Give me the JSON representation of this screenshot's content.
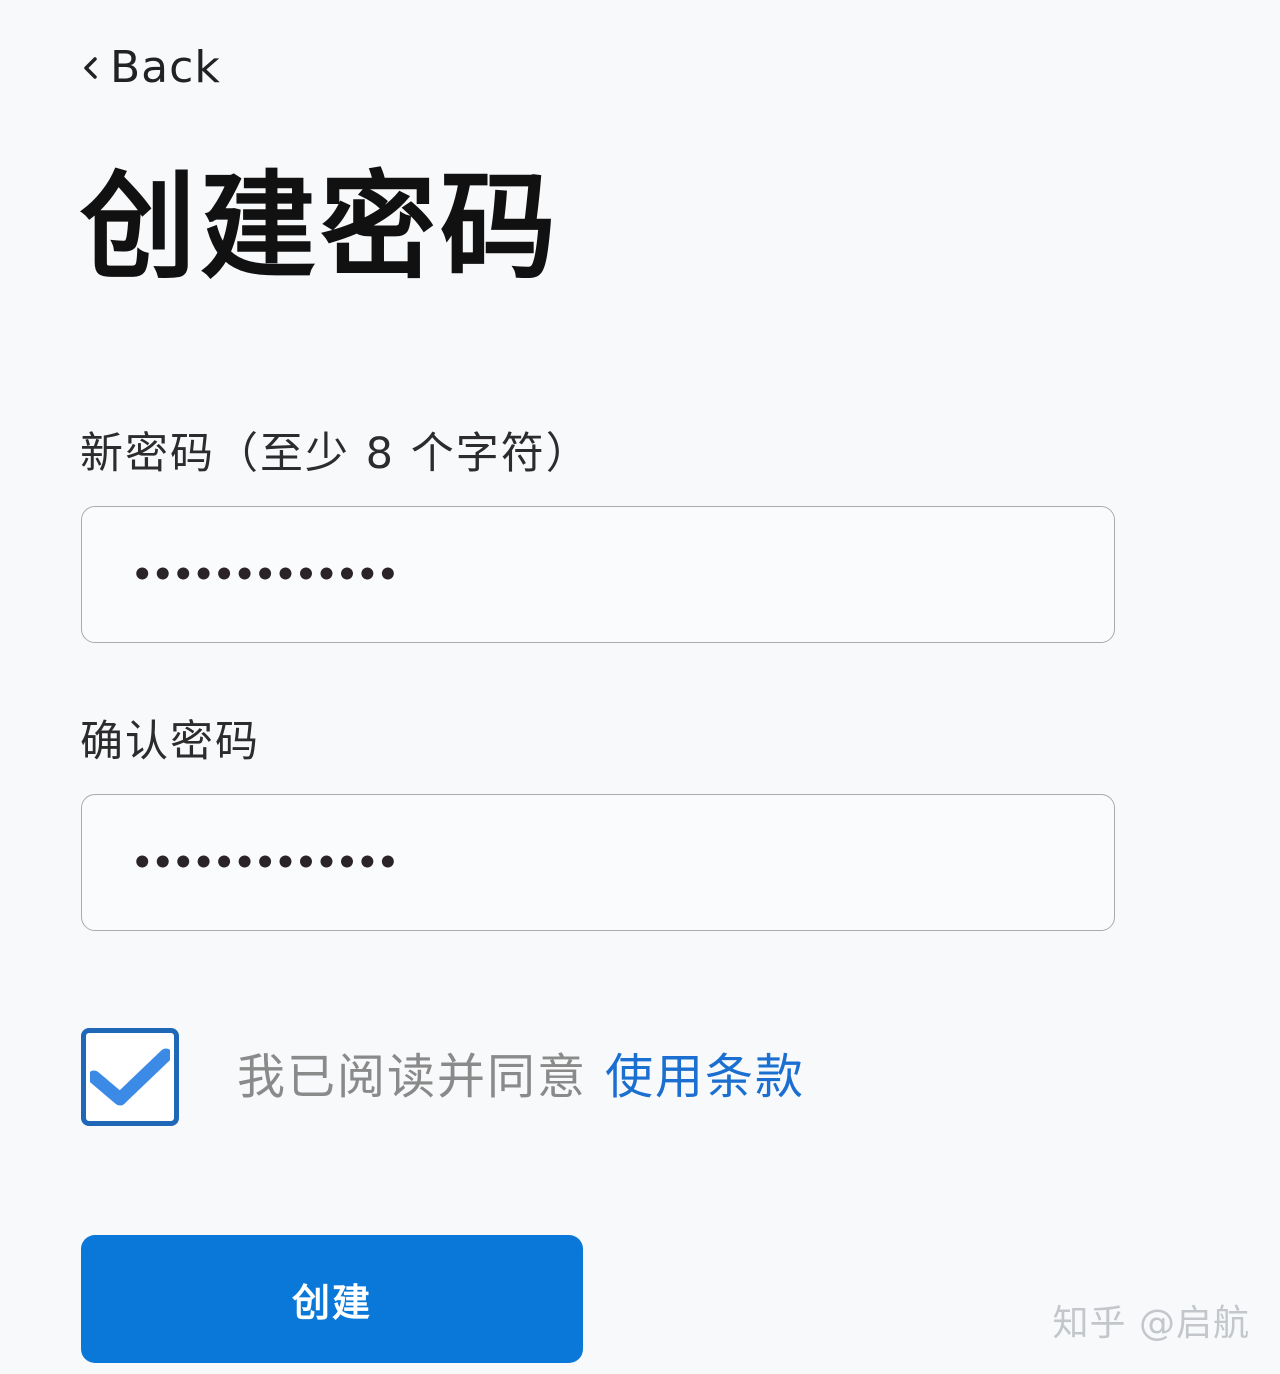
{
  "header": {
    "back_label": "Back",
    "title": "创建密码"
  },
  "form": {
    "new_password": {
      "label": "新密码（至少 8 个字符）",
      "value_mask": "•••••••••••••"
    },
    "confirm_password": {
      "label": "确认密码",
      "value_mask": "•••••••••••••"
    },
    "terms": {
      "checked": true,
      "text": "我已阅读并同意",
      "link_text": "使用条款"
    },
    "submit_label": "创建"
  },
  "watermark": "知乎 @启航",
  "colors": {
    "background": "#f8f9fb",
    "accent": "#0a78d8",
    "link": "#1a6fd1",
    "checkbox_border": "#1f68b8",
    "check": "#3b8ae6"
  },
  "icons": {
    "back": "chevron-left-icon",
    "check": "checkmark-icon"
  }
}
